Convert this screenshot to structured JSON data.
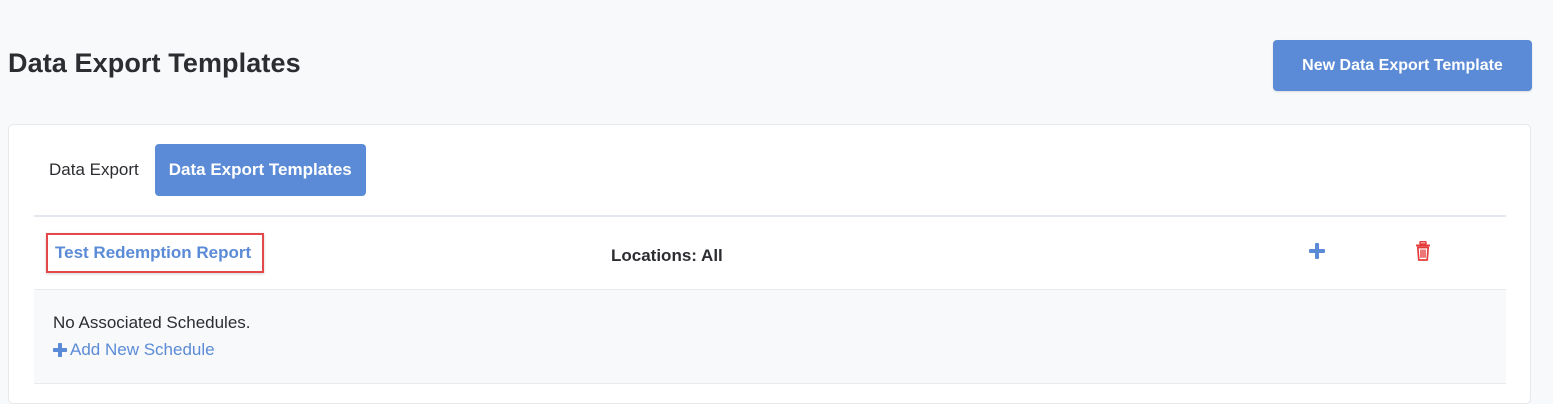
{
  "header": {
    "title": "Data Export Templates",
    "new_button_label": "New Data Export Template"
  },
  "tabs": [
    {
      "label": "Data Export",
      "active": false
    },
    {
      "label": "Data Export Templates",
      "active": true
    }
  ],
  "templates": [
    {
      "name": "Test Redemption Report",
      "locations": "Locations: All",
      "add_icon": "plus-icon",
      "delete_icon": "trash-icon",
      "schedules_text": "No Associated Schedules.",
      "add_schedule_label": "Add New Schedule"
    }
  ],
  "colors": {
    "accent": "#5b8bd6",
    "delete": "#e53b3b",
    "highlight_border": "#e54848"
  }
}
